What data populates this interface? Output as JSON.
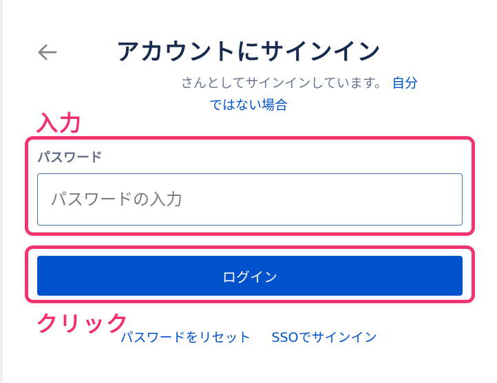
{
  "header": {
    "title": "アカウントにサインイン",
    "back_icon": "arrow-left-icon"
  },
  "account_notice": {
    "text": "さんとしてサインインしています。",
    "not_you_link_part1": "自分",
    "not_you_link_part2": "ではない場合"
  },
  "annotations": {
    "input_label": "入力",
    "click_label": "クリック",
    "highlight_color": "#f2346f"
  },
  "form": {
    "password_label": "パスワード",
    "password_placeholder": "パスワードの入力",
    "password_value": "",
    "login_button_label": "ログイン"
  },
  "footer": {
    "reset_password_link": "パスワードをリセット",
    "sso_link": "SSOでサインイン"
  },
  "colors": {
    "brand_blue": "#0052cc",
    "title_text": "#172b4d",
    "muted_text": "#6b778c"
  }
}
